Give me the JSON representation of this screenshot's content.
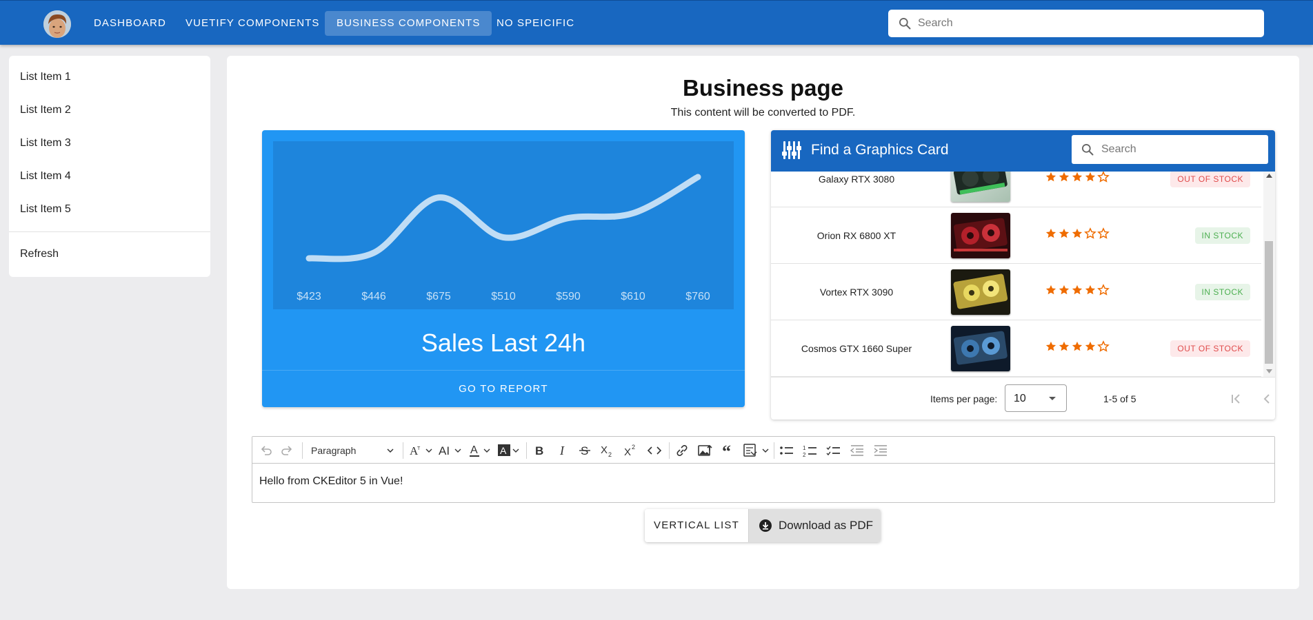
{
  "appbar": {
    "nav": [
      {
        "label": "DASHBOARD",
        "active": false
      },
      {
        "label": "VUETIFY COMPONENTS",
        "active": false
      },
      {
        "label": "BUSINESS COMPONENTS",
        "active": true
      },
      {
        "label": "NO SPEICIFIC",
        "active": false
      }
    ],
    "search_placeholder": "Search",
    "avatar_icon": "user-avatar",
    "search_icon": "search-icon",
    "color": "#1867c0"
  },
  "sidebar": {
    "items": [
      {
        "label": "List Item 1"
      },
      {
        "label": "List Item 2"
      },
      {
        "label": "List Item 3"
      },
      {
        "label": "List Item 4"
      },
      {
        "label": "List Item 5"
      }
    ],
    "refresh_label": "Refresh"
  },
  "page": {
    "title": "Business page",
    "subtitle": "This content will be converted to PDF."
  },
  "sales": {
    "title": "Sales Last 24h",
    "button_label": "GO TO REPORT",
    "color": "#2196f3",
    "chart_data": {
      "type": "line",
      "categories": [
        "$423",
        "$446",
        "$675",
        "$510",
        "$590",
        "$610",
        "$760"
      ],
      "values": [
        423,
        446,
        675,
        510,
        590,
        610,
        760
      ],
      "smooth": true,
      "grid": false
    }
  },
  "gpu": {
    "title": "Find a Graphics Card",
    "title_icon": "tune-sliders-icon",
    "search_placeholder": "Search",
    "rows": [
      {
        "name": "Galaxy RTX 3080",
        "rating": 4,
        "status": "OUT OF STOCK",
        "in_stock": false,
        "image": "green-gpu-image"
      },
      {
        "name": "Orion RX 6800 XT",
        "rating": 3,
        "status": "IN STOCK",
        "in_stock": true,
        "image": "red-gpu-image"
      },
      {
        "name": "Vortex RTX 3090",
        "rating": 4,
        "status": "IN STOCK",
        "in_stock": true,
        "image": "gold-gpu-image"
      },
      {
        "name": "Cosmos GTX 1660 Super",
        "rating": 4,
        "status": "OUT OF STOCK",
        "in_stock": false,
        "image": "blue-gpu-image"
      }
    ],
    "footer": {
      "items_per_page_label": "Items per page:",
      "items_per_page_value": "10",
      "range": "1-5 of 5"
    },
    "star_color": "#ef6c00"
  },
  "editor": {
    "paragraph_label": "Paragraph",
    "content": "Hello from CKEditor 5 in Vue!"
  },
  "actions": {
    "vertical_list_label": "VERTICAL LIST",
    "download_label": "Download as PDF"
  }
}
